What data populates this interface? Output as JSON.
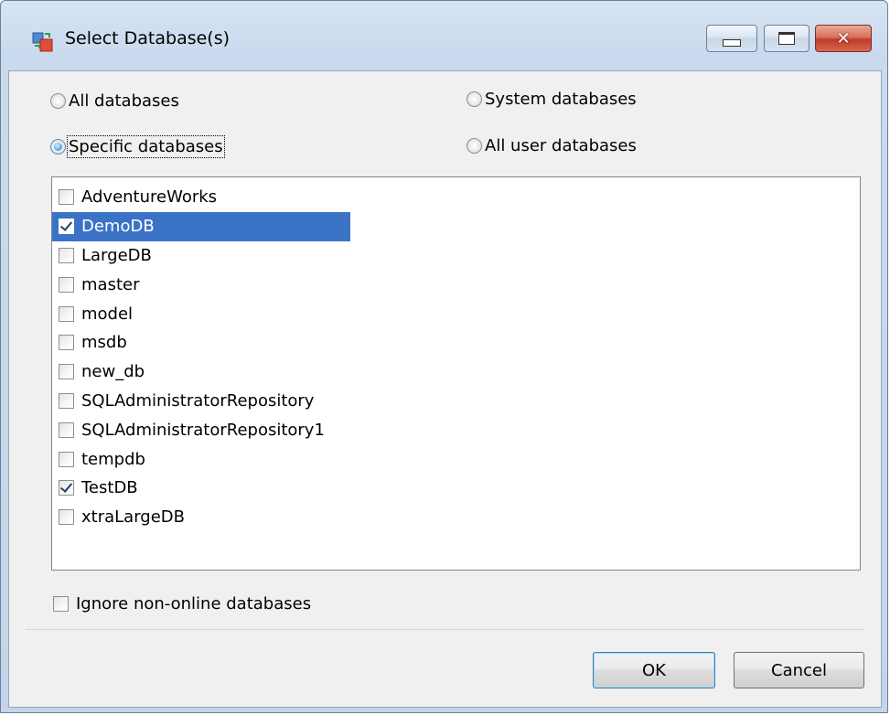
{
  "window": {
    "title": "Select Database(s)",
    "icon": "database-transfer-icon",
    "controls": {
      "minimize": "minimize-icon",
      "maximize": "maximize-icon",
      "close": "close-icon",
      "close_glyph": "✕"
    }
  },
  "scope": {
    "options": [
      {
        "label": "All databases",
        "checked": false
      },
      {
        "label": "Specific databases",
        "checked": true
      },
      {
        "label": "System databases",
        "checked": false
      },
      {
        "label": "All user databases",
        "checked": false
      }
    ]
  },
  "databases": [
    {
      "name": "AdventureWorks",
      "checked": false,
      "selected": false
    },
    {
      "name": "DemoDB",
      "checked": true,
      "selected": true
    },
    {
      "name": "LargeDB",
      "checked": false,
      "selected": false
    },
    {
      "name": "master",
      "checked": false,
      "selected": false
    },
    {
      "name": "model",
      "checked": false,
      "selected": false
    },
    {
      "name": "msdb",
      "checked": false,
      "selected": false
    },
    {
      "name": "new_db",
      "checked": false,
      "selected": false
    },
    {
      "name": "SQLAdministratorRepository",
      "checked": false,
      "selected": false
    },
    {
      "name": "SQLAdministratorRepository1",
      "checked": false,
      "selected": false
    },
    {
      "name": "tempdb",
      "checked": false,
      "selected": false
    },
    {
      "name": "TestDB",
      "checked": true,
      "selected": false
    },
    {
      "name": "xtraLargeDB",
      "checked": false,
      "selected": false
    }
  ],
  "ignore_offline": {
    "label": "Ignore non-online databases",
    "checked": false
  },
  "buttons": {
    "ok": "OK",
    "cancel": "Cancel"
  },
  "colors": {
    "selection": "#3a73c6",
    "dialog_bg": "#f0f0f0",
    "frame": "#c9daee"
  }
}
